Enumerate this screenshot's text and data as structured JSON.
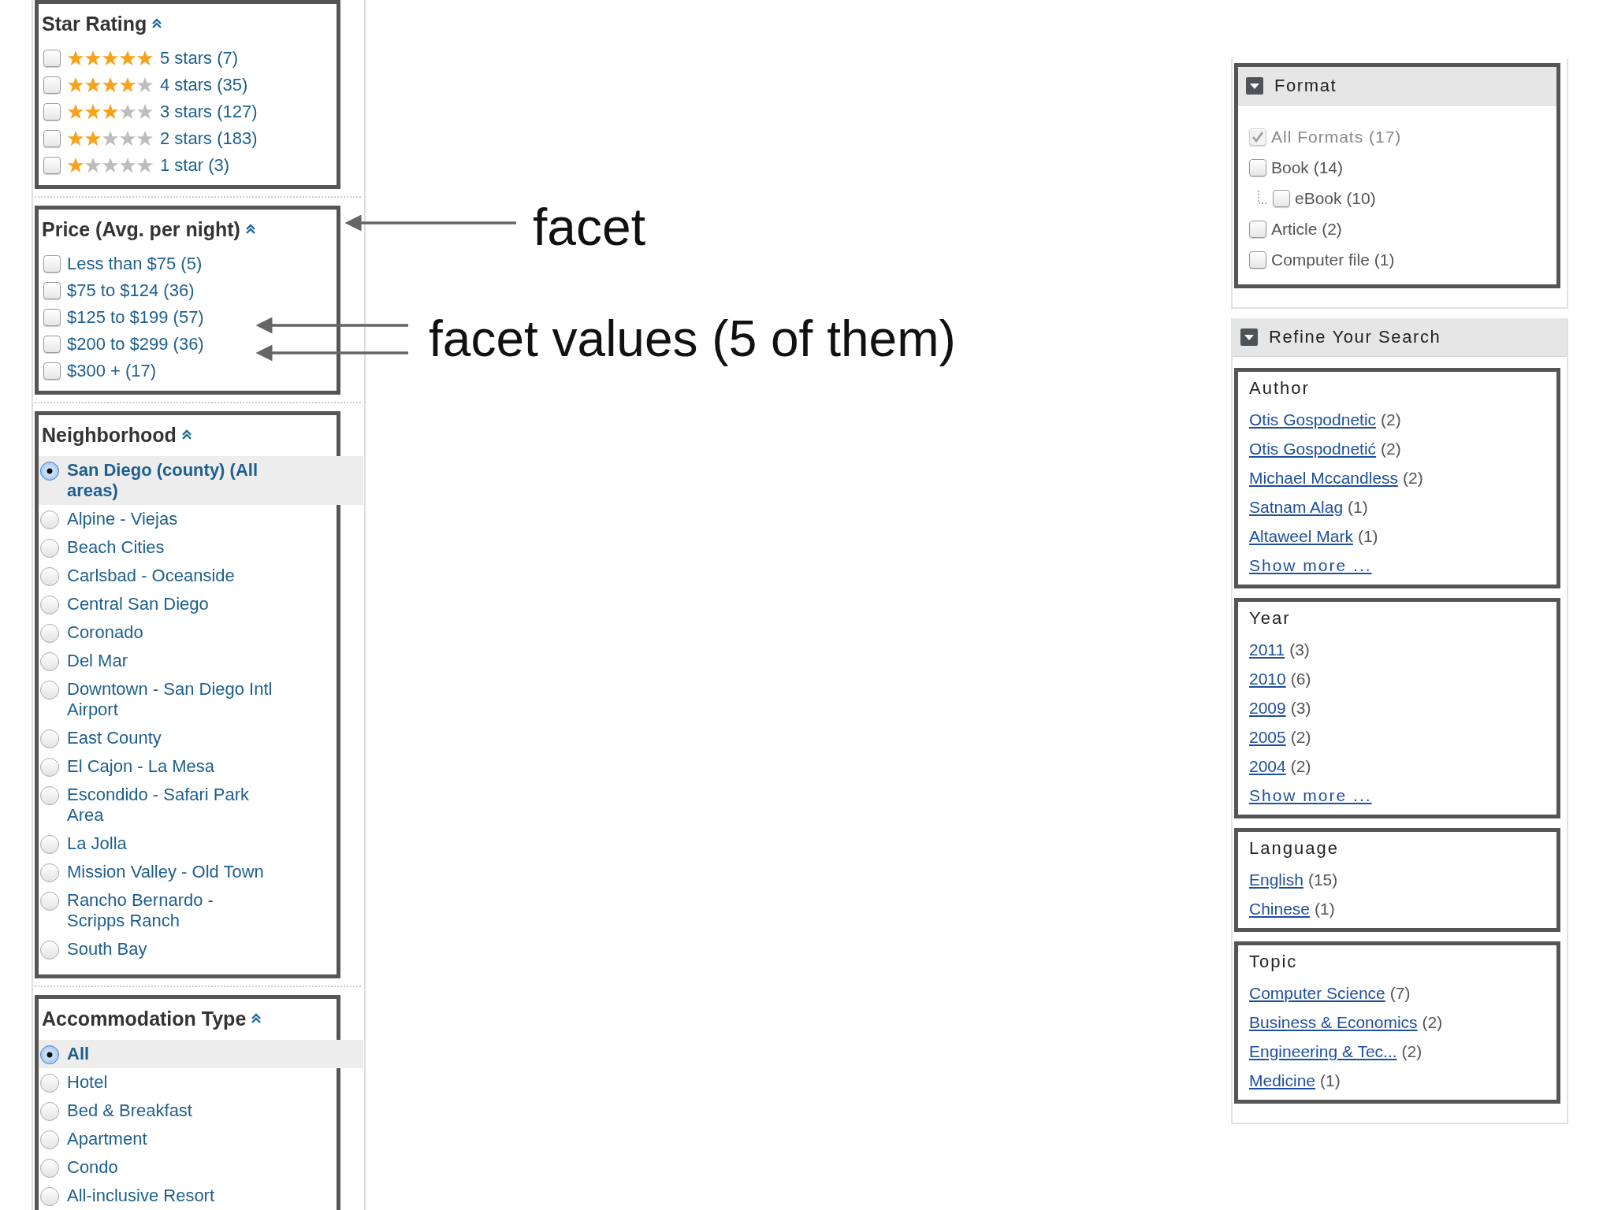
{
  "left_facets": [
    {
      "title": "Star Rating",
      "kind": "stars",
      "options": [
        {
          "stars": 5,
          "label": "5 stars (7)",
          "checked": false
        },
        {
          "stars": 4,
          "label": "4 stars (35)",
          "checked": false
        },
        {
          "stars": 3,
          "label": "3 stars (127)",
          "checked": false
        },
        {
          "stars": 2,
          "label": "2 stars (183)",
          "checked": false
        },
        {
          "stars": 1,
          "label": "1 star (3)",
          "checked": false
        }
      ]
    },
    {
      "title": "Price (Avg. per night)",
      "kind": "checkbox",
      "options": [
        {
          "label": "Less than $75 (5)",
          "checked": false
        },
        {
          "label": "$75 to $124 (36)",
          "checked": false
        },
        {
          "label": "$125 to $199 (57)",
          "checked": false
        },
        {
          "label": "$200 to $299 (36)",
          "checked": false
        },
        {
          "label": "$300 + (17)",
          "checked": false
        }
      ]
    },
    {
      "title": "Neighborhood",
      "kind": "radio",
      "options": [
        {
          "label": "San Diego (county) (All areas)",
          "selected": true
        },
        {
          "label": "Alpine - Viejas",
          "selected": false
        },
        {
          "label": "Beach Cities",
          "selected": false
        },
        {
          "label": "Carlsbad - Oceanside",
          "selected": false
        },
        {
          "label": "Central San Diego",
          "selected": false
        },
        {
          "label": "Coronado",
          "selected": false
        },
        {
          "label": "Del Mar",
          "selected": false
        },
        {
          "label": "Downtown - San Diego Intl Airport",
          "selected": false
        },
        {
          "label": "East County",
          "selected": false
        },
        {
          "label": "El Cajon - La Mesa",
          "selected": false
        },
        {
          "label": "Escondido - Safari Park Area",
          "selected": false
        },
        {
          "label": "La Jolla",
          "selected": false
        },
        {
          "label": "Mission Valley - Old Town",
          "selected": false
        },
        {
          "label": "Rancho Bernardo - Scripps Ranch",
          "selected": false
        },
        {
          "label": "South Bay",
          "selected": false
        }
      ]
    },
    {
      "title": "Accommodation Type",
      "kind": "radio",
      "options": [
        {
          "label": "All",
          "selected": true
        },
        {
          "label": "Hotel",
          "selected": false
        },
        {
          "label": "Bed & Breakfast",
          "selected": false
        },
        {
          "label": "Apartment",
          "selected": false
        },
        {
          "label": "Condo",
          "selected": false
        },
        {
          "label": "All-inclusive Resort",
          "selected": false
        }
      ]
    }
  ],
  "annotations": [
    {
      "text": "facet"
    },
    {
      "text": "facet values (5 of them)"
    }
  ],
  "format_panel": {
    "title": "Format",
    "options": [
      {
        "label": "All Formats (17)",
        "checked": true,
        "disabled": true
      },
      {
        "label": "Book (14)",
        "checked": false,
        "disabled": false,
        "children": [
          {
            "label": "eBook (10)",
            "checked": false,
            "disabled": false
          }
        ]
      },
      {
        "label": "Article (2)",
        "checked": false,
        "disabled": false
      },
      {
        "label": "Computer file (1)",
        "checked": false,
        "disabled": false
      }
    ]
  },
  "refine_panel": {
    "title": "Refine Your Search",
    "groups": [
      {
        "title": "Author",
        "links": [
          {
            "label": "Otis Gospodnetic",
            "count": "(2)"
          },
          {
            "label": "Otis Gospodnetić",
            "count": "(2)"
          },
          {
            "label": "Michael Mccandless",
            "count": "(2)"
          },
          {
            "label": "Satnam Alag",
            "count": "(1)"
          },
          {
            "label": "Altaweel Mark",
            "count": "(1)"
          }
        ],
        "show_more": "Show more ..."
      },
      {
        "title": "Year",
        "links": [
          {
            "label": "2011",
            "count": "(3)"
          },
          {
            "label": "2010",
            "count": "(6)"
          },
          {
            "label": "2009",
            "count": "(3)"
          },
          {
            "label": "2005",
            "count": "(2)"
          },
          {
            "label": "2004",
            "count": "(2)"
          }
        ],
        "show_more": "Show more ..."
      },
      {
        "title": "Language",
        "links": [
          {
            "label": "English",
            "count": "(15)"
          },
          {
            "label": "Chinese",
            "count": "(1)"
          }
        ]
      },
      {
        "title": "Topic",
        "links": [
          {
            "label": "Computer Science",
            "count": "(7)"
          },
          {
            "label": "Business & Economics",
            "count": "(2)"
          },
          {
            "label": "Engineering & Tec...",
            "count": "(2)"
          },
          {
            "label": "Medicine",
            "count": "(1)"
          }
        ]
      }
    ]
  }
}
